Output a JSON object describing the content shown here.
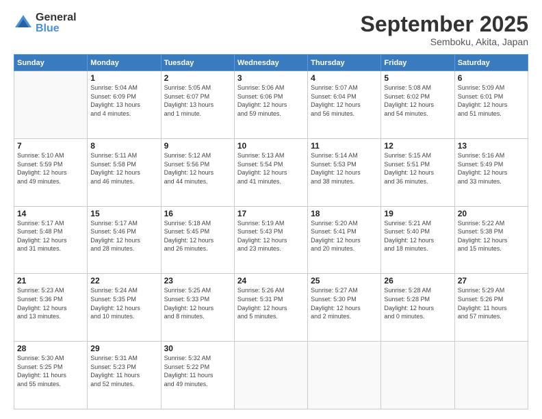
{
  "logo": {
    "general": "General",
    "blue": "Blue"
  },
  "header": {
    "month": "September 2025",
    "location": "Semboku, Akita, Japan"
  },
  "days_of_week": [
    "Sunday",
    "Monday",
    "Tuesday",
    "Wednesday",
    "Thursday",
    "Friday",
    "Saturday"
  ],
  "weeks": [
    [
      {
        "day": "",
        "info": ""
      },
      {
        "day": "1",
        "info": "Sunrise: 5:04 AM\nSunset: 6:09 PM\nDaylight: 13 hours\nand 4 minutes."
      },
      {
        "day": "2",
        "info": "Sunrise: 5:05 AM\nSunset: 6:07 PM\nDaylight: 13 hours\nand 1 minute."
      },
      {
        "day": "3",
        "info": "Sunrise: 5:06 AM\nSunset: 6:06 PM\nDaylight: 12 hours\nand 59 minutes."
      },
      {
        "day": "4",
        "info": "Sunrise: 5:07 AM\nSunset: 6:04 PM\nDaylight: 12 hours\nand 56 minutes."
      },
      {
        "day": "5",
        "info": "Sunrise: 5:08 AM\nSunset: 6:02 PM\nDaylight: 12 hours\nand 54 minutes."
      },
      {
        "day": "6",
        "info": "Sunrise: 5:09 AM\nSunset: 6:01 PM\nDaylight: 12 hours\nand 51 minutes."
      }
    ],
    [
      {
        "day": "7",
        "info": "Sunrise: 5:10 AM\nSunset: 5:59 PM\nDaylight: 12 hours\nand 49 minutes."
      },
      {
        "day": "8",
        "info": "Sunrise: 5:11 AM\nSunset: 5:58 PM\nDaylight: 12 hours\nand 46 minutes."
      },
      {
        "day": "9",
        "info": "Sunrise: 5:12 AM\nSunset: 5:56 PM\nDaylight: 12 hours\nand 44 minutes."
      },
      {
        "day": "10",
        "info": "Sunrise: 5:13 AM\nSunset: 5:54 PM\nDaylight: 12 hours\nand 41 minutes."
      },
      {
        "day": "11",
        "info": "Sunrise: 5:14 AM\nSunset: 5:53 PM\nDaylight: 12 hours\nand 38 minutes."
      },
      {
        "day": "12",
        "info": "Sunrise: 5:15 AM\nSunset: 5:51 PM\nDaylight: 12 hours\nand 36 minutes."
      },
      {
        "day": "13",
        "info": "Sunrise: 5:16 AM\nSunset: 5:49 PM\nDaylight: 12 hours\nand 33 minutes."
      }
    ],
    [
      {
        "day": "14",
        "info": "Sunrise: 5:17 AM\nSunset: 5:48 PM\nDaylight: 12 hours\nand 31 minutes."
      },
      {
        "day": "15",
        "info": "Sunrise: 5:17 AM\nSunset: 5:46 PM\nDaylight: 12 hours\nand 28 minutes."
      },
      {
        "day": "16",
        "info": "Sunrise: 5:18 AM\nSunset: 5:45 PM\nDaylight: 12 hours\nand 26 minutes."
      },
      {
        "day": "17",
        "info": "Sunrise: 5:19 AM\nSunset: 5:43 PM\nDaylight: 12 hours\nand 23 minutes."
      },
      {
        "day": "18",
        "info": "Sunrise: 5:20 AM\nSunset: 5:41 PM\nDaylight: 12 hours\nand 20 minutes."
      },
      {
        "day": "19",
        "info": "Sunrise: 5:21 AM\nSunset: 5:40 PM\nDaylight: 12 hours\nand 18 minutes."
      },
      {
        "day": "20",
        "info": "Sunrise: 5:22 AM\nSunset: 5:38 PM\nDaylight: 12 hours\nand 15 minutes."
      }
    ],
    [
      {
        "day": "21",
        "info": "Sunrise: 5:23 AM\nSunset: 5:36 PM\nDaylight: 12 hours\nand 13 minutes."
      },
      {
        "day": "22",
        "info": "Sunrise: 5:24 AM\nSunset: 5:35 PM\nDaylight: 12 hours\nand 10 minutes."
      },
      {
        "day": "23",
        "info": "Sunrise: 5:25 AM\nSunset: 5:33 PM\nDaylight: 12 hours\nand 8 minutes."
      },
      {
        "day": "24",
        "info": "Sunrise: 5:26 AM\nSunset: 5:31 PM\nDaylight: 12 hours\nand 5 minutes."
      },
      {
        "day": "25",
        "info": "Sunrise: 5:27 AM\nSunset: 5:30 PM\nDaylight: 12 hours\nand 2 minutes."
      },
      {
        "day": "26",
        "info": "Sunrise: 5:28 AM\nSunset: 5:28 PM\nDaylight: 12 hours\nand 0 minutes."
      },
      {
        "day": "27",
        "info": "Sunrise: 5:29 AM\nSunset: 5:26 PM\nDaylight: 11 hours\nand 57 minutes."
      }
    ],
    [
      {
        "day": "28",
        "info": "Sunrise: 5:30 AM\nSunset: 5:25 PM\nDaylight: 11 hours\nand 55 minutes."
      },
      {
        "day": "29",
        "info": "Sunrise: 5:31 AM\nSunset: 5:23 PM\nDaylight: 11 hours\nand 52 minutes."
      },
      {
        "day": "30",
        "info": "Sunrise: 5:32 AM\nSunset: 5:22 PM\nDaylight: 11 hours\nand 49 minutes."
      },
      {
        "day": "",
        "info": ""
      },
      {
        "day": "",
        "info": ""
      },
      {
        "day": "",
        "info": ""
      },
      {
        "day": "",
        "info": ""
      }
    ]
  ]
}
